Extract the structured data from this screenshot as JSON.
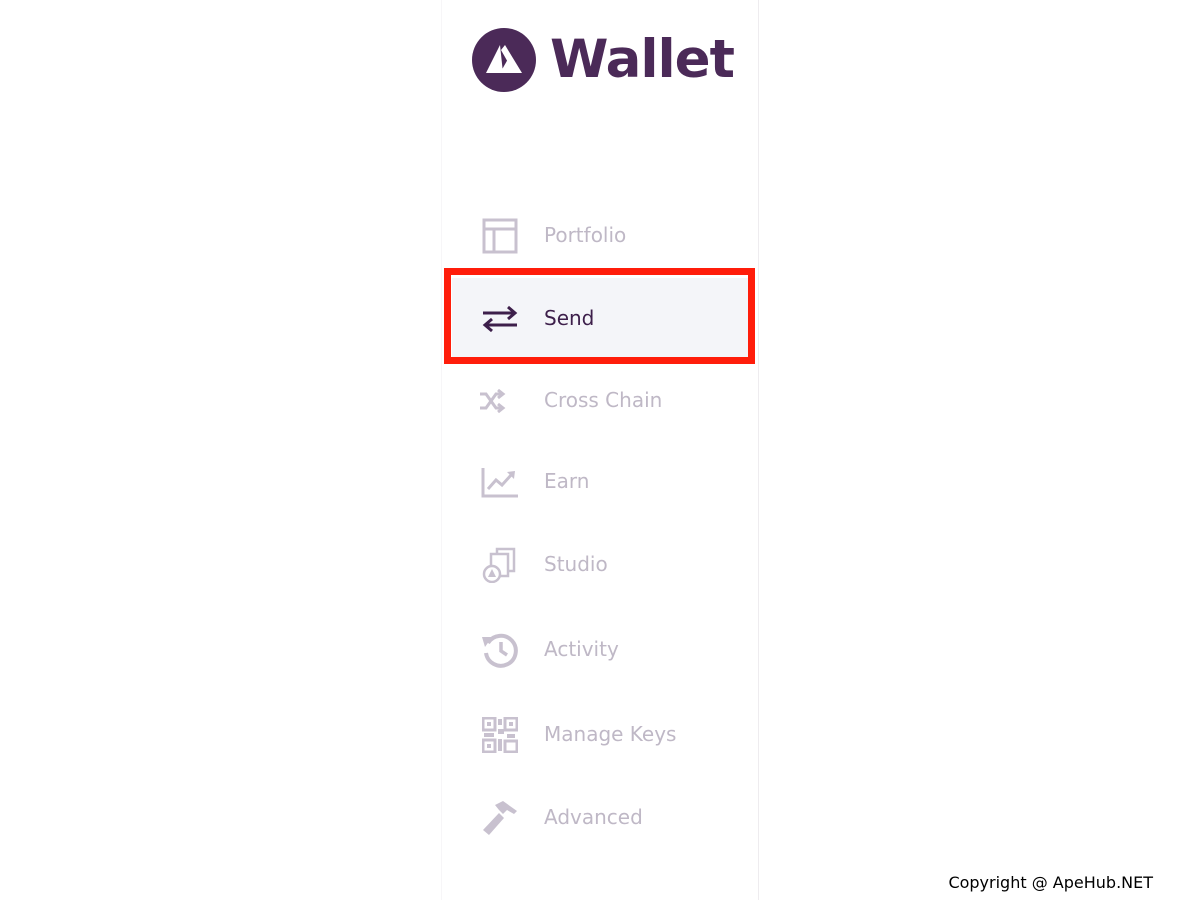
{
  "app": {
    "brand": "Wallet",
    "logo_icon": "avalanche-logo-icon",
    "brand_color": "#4b2a58"
  },
  "sidebar": {
    "items": [
      {
        "label": "Portfolio",
        "icon": "portfolio-icon",
        "active": false
      },
      {
        "label": "Send",
        "icon": "transfer-arrows-icon",
        "active": true
      },
      {
        "label": "Cross Chain",
        "icon": "shuffle-icon",
        "active": false
      },
      {
        "label": "Earn",
        "icon": "chart-trend-icon",
        "active": false
      },
      {
        "label": "Studio",
        "icon": "studio-icon",
        "active": false
      },
      {
        "label": "Activity",
        "icon": "history-icon",
        "active": false
      },
      {
        "label": "Manage Keys",
        "icon": "qr-code-icon",
        "active": false
      },
      {
        "label": "Advanced",
        "icon": "hammer-icon",
        "active": false
      }
    ],
    "inactive_color": "#bfb8c6",
    "active_color": "#3d1f4b",
    "highlight_color": "#ff1d0b"
  },
  "footer": {
    "copyright": "Copyright @ ApeHub.NET"
  }
}
